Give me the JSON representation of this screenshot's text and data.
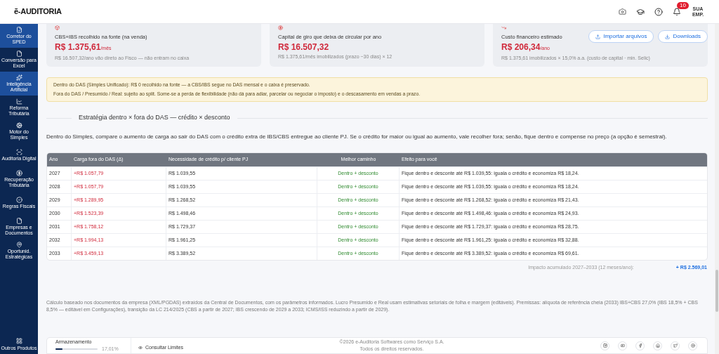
{
  "header": {
    "logo": "ẽ-AUDITORIA",
    "notifications": "10",
    "company": "SUA EMP."
  },
  "sidebar": {
    "items": [
      {
        "label": "Corretor do SPED",
        "selected": true
      },
      {
        "label": "Conversão para Excel",
        "selected": false
      },
      {
        "label": "Inteligência Artificial",
        "selected": true
      },
      {
        "label": "Reforma Tributária",
        "selected": false
      },
      {
        "label": "Motor do Simples",
        "selected": false
      },
      {
        "label": "Auditoria Digital",
        "selected": false
      },
      {
        "label": "Recuperação Tributária",
        "selected": false
      },
      {
        "label": "Regras Fiscais",
        "selected": false
      },
      {
        "label": "Empresas e Documentos",
        "selected": false
      },
      {
        "label": "Oportunid. Estratégicas",
        "selected": false
      }
    ],
    "bottom": {
      "label": "Outros Produtos"
    }
  },
  "cards": [
    {
      "label": "CBS+IBS recolhido na fonte (na venda)",
      "value": "R$ 1.375,61",
      "unit": "/mês",
      "note": "R$ 16.507,32/ano vão direto ao Fisco — não entram no caixa"
    },
    {
      "label": "Capital de giro que deixa de circular por ano",
      "value": "R$ 16.507,32",
      "note": "R$ 1.375,61/mês imobilizados (prazo ~30 dias) × 12"
    },
    {
      "label": "Custo financeiro estimado",
      "value": "R$ 206,34",
      "unit": "/ano",
      "note": "R$ 1.375,61 imobilizados × 15,0% a.a. (custo de capital · min. Selic)"
    }
  ],
  "actions": [
    "Importar arquivos",
    "Downloads"
  ],
  "alert": [
    "Dentro do DAS (Simples Unificado): R$ 0 recolhido na fonte — a CBS/IBS segue no DAS mensal e o caixa é preservado.",
    "Fora do DAS / Presumido / Real: sujeito ao split. Some-se a perda de flexibilidade (não dá para adiar, parcelar ou negociar o imposto) e o descasamento em vendas a prazo."
  ],
  "section": {
    "title": "Estratégia dentro × fora do DAS — crédito × desconto",
    "intro": "Dentro do Simples, compare o aumento de carga ao sair do DAS com o crédito extra de IBS/CBS entregue ao cliente PJ. Se o crédito for maior ou igual ao aumento, vale recolher fora; senão, fique dentro e compense no preço (a opção é semestral)."
  },
  "table": {
    "columns": [
      "Ano",
      "Carga fora do DAS (Δ)",
      "Necessidade de crédito p/ cliente PJ",
      "Melhor caminho",
      "Efeito para você"
    ],
    "rows": [
      [
        "2027",
        "+R$ 1.057,79",
        "R$ 1.039,55",
        "Dentro + desconto",
        "Fique dentro e desconte até R$ 1.039,55: iguala o crédito e economiza R$ 18,24."
      ],
      [
        "2028",
        "+R$ 1.057,79",
        "R$ 1.039,55",
        "Dentro + desconto",
        "Fique dentro e desconte até R$ 1.039,55: iguala o crédito e economiza R$ 18,24."
      ],
      [
        "2029",
        "+R$ 1.289,95",
        "R$ 1.268,52",
        "Dentro + desconto",
        "Fique dentro e desconte até R$ 1.268,52: iguala o crédito e economiza R$ 21,43."
      ],
      [
        "2030",
        "+R$ 1.523,39",
        "R$ 1.498,46",
        "Dentro + desconto",
        "Fique dentro e desconte até R$ 1.498,46: iguala o crédito e economiza R$ 24,93."
      ],
      [
        "2031",
        "+R$ 1.758,12",
        "R$ 1.729,37",
        "Dentro + desconto",
        "Fique dentro e desconte até R$ 1.729,37: iguala o crédito e economiza R$ 28,75."
      ],
      [
        "2032",
        "+R$ 1.994,13",
        "R$ 1.961,25",
        "Dentro + desconto",
        "Fique dentro e desconte até R$ 1.961,25: iguala o crédito e economiza R$ 32,88."
      ],
      [
        "2033",
        "+R$ 3.459,13",
        "R$ 3.389,52",
        "Dentro + desconto",
        "Fique dentro e desconte até R$ 3.389,52: iguala o crédito e economiza R$ 69,61."
      ]
    ],
    "total_label": "Impacto acumulado 2027–2033 (12 meses/ano):",
    "total_value": "+ R$ 2.569,01"
  },
  "footnote": "Cálculo baseado nos documentos da empresa (XML/PGDAS) extraídos da Central de Documentos, com os parâmetros informados. Lucro Presumido e Real usam estimativas setoriais de folha e margem (editáveis). Premissas: alíquota de referência cheia (2033) IBS+CBS 27,0% (IBS 18,5% + CBS 8,5% — editável em Configurações), transição da LC 214/2025 (CBS a partir de 2027; IBS crescendo de 2029 a 2033; ICMS/ISS reduzindo a partir de 2029).",
  "footer": {
    "storage": {
      "label": "Armazenamento",
      "percent": "17,01%",
      "level": 0.1701
    },
    "limits": "Consultar Limites",
    "copyright": [
      "©2026 e-Auditoria Softwares como Serviço S.A.",
      "Todos os direitos reservados."
    ]
  }
}
